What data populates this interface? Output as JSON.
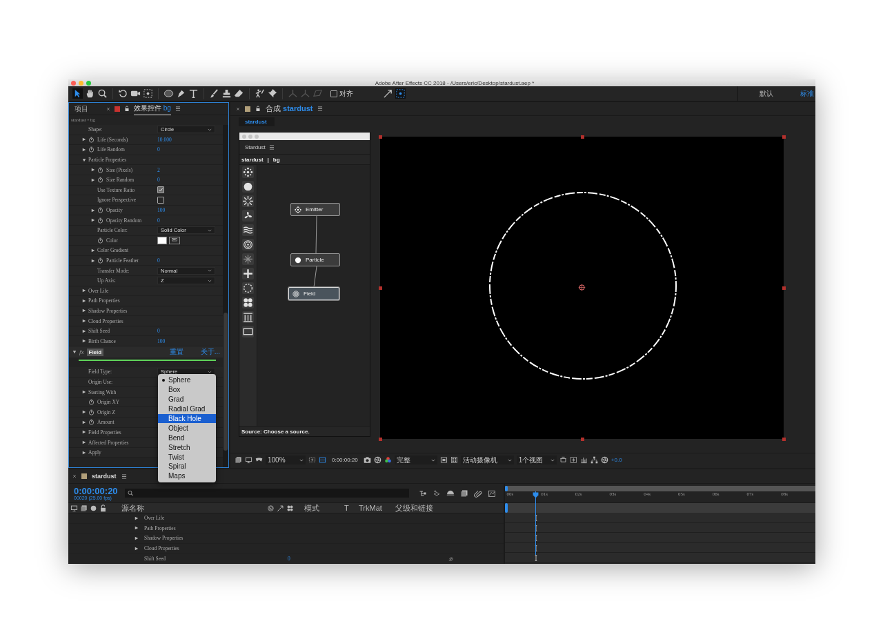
{
  "window": {
    "title": "Adobe After Effects CC 2018 - /Users/eric/Desktop/stardust.aep *"
  },
  "toolbar": {
    "snapping": {
      "label": "对齐",
      "checked": false
    },
    "workspaces": [
      {
        "label": "默认",
        "selected": false
      },
      {
        "label": "标准",
        "selected": true
      }
    ]
  },
  "effect_controls": {
    "tabs": [
      {
        "label": "项目",
        "selected": false
      },
      {
        "label": "效果控件",
        "layer": "bg",
        "selected": true
      }
    ],
    "breadcrumb": "stardust • bg",
    "properties": [
      {
        "label": "Shape:",
        "kind": "dropdown",
        "value": "Circle"
      },
      {
        "label": "Life (Seconds)",
        "kind": "number",
        "value": "10.000",
        "expanded": false,
        "stopwatch": true
      },
      {
        "label": "Life Random",
        "kind": "number",
        "value": "0",
        "expanded": false,
        "stopwatch": true
      },
      {
        "label": "Particle Properties",
        "kind": "group",
        "expanded": true,
        "children": [
          {
            "label": "Size (Pixels)",
            "kind": "number",
            "value": "2",
            "expanded": false,
            "stopwatch": true
          },
          {
            "label": "Size Random",
            "kind": "number",
            "value": "0",
            "expanded": false,
            "stopwatch": true
          },
          {
            "label": "Use Texture Ratio",
            "kind": "checkbox",
            "checked": true
          },
          {
            "label": "Ignore Perspective",
            "kind": "checkbox",
            "checked": false
          },
          {
            "label": "Opacity",
            "kind": "number",
            "value": "100",
            "expanded": false,
            "stopwatch": true
          },
          {
            "label": "Opacity Random",
            "kind": "number",
            "value": "0",
            "expanded": false,
            "stopwatch": true
          },
          {
            "label": "Particle Color:",
            "kind": "dropdown",
            "value": "Solid Color"
          },
          {
            "label": "Color",
            "kind": "color",
            "color": "#ffffff",
            "stopwatch": true
          },
          {
            "label": "Color Gradient",
            "kind": "group",
            "expanded": false
          },
          {
            "label": "Particle Feather",
            "kind": "number",
            "value": "0",
            "expanded": false,
            "stopwatch": true
          },
          {
            "label": "Transfer Mode:",
            "kind": "dropdown",
            "value": "Normal"
          },
          {
            "label": "Up Axis:",
            "kind": "dropdown",
            "value": "Z"
          }
        ]
      },
      {
        "label": "Over Life",
        "kind": "group",
        "expanded": false
      },
      {
        "label": "Path Properties",
        "kind": "group",
        "expanded": false
      },
      {
        "label": "Shadow Properties",
        "kind": "group",
        "expanded": false
      },
      {
        "label": "Cloud Properties",
        "kind": "group",
        "expanded": false
      },
      {
        "label": "Shift Seed",
        "kind": "number",
        "value": "0",
        "expanded": false
      },
      {
        "label": "Birth Chance",
        "kind": "number",
        "value": "100",
        "expanded": false
      }
    ],
    "effect": {
      "badge": "fx",
      "name": "Field",
      "expanded": true,
      "reset": "重置",
      "about": "关于...",
      "properties": [
        {
          "label": "Field Type:",
          "kind": "dropdown",
          "value": "Sphere"
        },
        {
          "label": "Origin Use:",
          "kind": "label"
        },
        {
          "label": "Starting With",
          "kind": "group",
          "expanded": false
        },
        {
          "label": "Origin XY",
          "kind": "label",
          "stopwatch": true
        },
        {
          "label": "Origin Z",
          "kind": "label",
          "expanded": false,
          "stopwatch": true
        },
        {
          "label": "Amount",
          "kind": "label",
          "expanded": false,
          "stopwatch": true
        },
        {
          "label": "Field Properties",
          "kind": "group",
          "expanded": false
        },
        {
          "label": "Affected Properties",
          "kind": "group",
          "expanded": false
        },
        {
          "label": "Apply",
          "kind": "group",
          "expanded": false
        }
      ]
    }
  },
  "field_type_menu": {
    "items": [
      {
        "label": "Sphere",
        "checked": true,
        "highlighted": false
      },
      {
        "label": "Box",
        "checked": false,
        "highlighted": false
      },
      {
        "label": "Grad",
        "checked": false,
        "highlighted": false
      },
      {
        "label": "Radial Grad",
        "checked": false,
        "highlighted": false
      },
      {
        "label": "Black Hole",
        "checked": false,
        "highlighted": true
      },
      {
        "label": "Object",
        "checked": false,
        "highlighted": false
      },
      {
        "label": "Bend",
        "checked": false,
        "highlighted": false
      },
      {
        "label": "Stretch",
        "checked": false,
        "highlighted": false
      },
      {
        "label": "Twist",
        "checked": false,
        "highlighted": false
      },
      {
        "label": "Spiral",
        "checked": false,
        "highlighted": false
      },
      {
        "label": "Maps",
        "checked": false,
        "highlighted": false
      }
    ]
  },
  "composition": {
    "tab": {
      "prefix": "合成",
      "name": "stardust"
    },
    "subtab": "stardust",
    "stardust_panel": {
      "title": "Stardust",
      "path": [
        "stardust",
        "bg"
      ],
      "separator": "|",
      "nodes": [
        {
          "label": "Emitter",
          "kind": "emitter",
          "selected": false
        },
        {
          "label": "Particle",
          "kind": "particle",
          "selected": false
        },
        {
          "label": "Field",
          "kind": "field",
          "selected": true
        }
      ],
      "status": "Source: Choose a source."
    },
    "viewer_bar": {
      "zoom": "100%",
      "timecode": "0:00:00:20",
      "resolution": "完整",
      "camera": "活动摄像机",
      "views": "1个视图",
      "exposure": "+0.0"
    }
  },
  "timeline": {
    "tab": "stardust",
    "timecode": "0:00:00:20",
    "frame_info": "00020 (25.00 fps)",
    "columns": [
      "源名称",
      "模式",
      "T",
      "TrkMat",
      "父级和链接"
    ],
    "ruler": [
      "00s",
      "01s",
      "02s",
      "03s",
      "04s",
      "05s",
      "06s",
      "07s",
      "08s"
    ],
    "rows": [
      {
        "label": "Over Life",
        "expanded": false
      },
      {
        "label": "Path Properties",
        "expanded": false
      },
      {
        "label": "Shadow Properties",
        "expanded": false
      },
      {
        "label": "Cloud Properties",
        "expanded": false
      },
      {
        "label": "Shift Seed",
        "value": "0"
      }
    ]
  }
}
